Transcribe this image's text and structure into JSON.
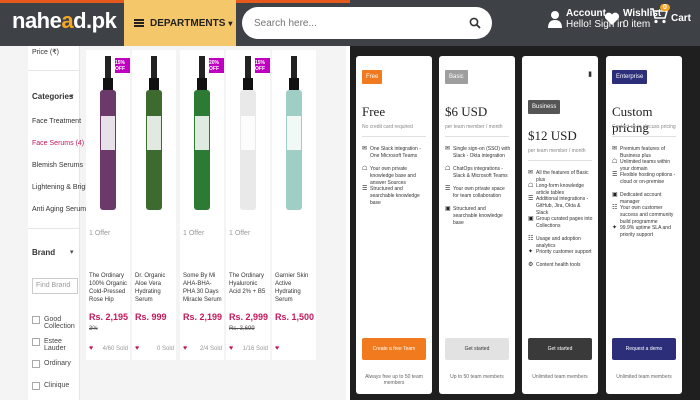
{
  "header": {
    "logo_text": "nahe",
    "logo_o": "e",
    "logo_tail": "d.pk",
    "departments_label": "DEPARTMENTS",
    "search_placeholder": "Search here...",
    "account_label": "Account",
    "account_sub": "Hello! Sign in",
    "wishlist_label": "Wishlist",
    "wishlist_sub": "0 item",
    "cart_label": "Cart",
    "cart_count": "0",
    "accent": "#f5a623",
    "header_bg": "#3e4146"
  },
  "sidebar": {
    "top_label": "Price (₹)",
    "categories_title": "Categories",
    "categories": [
      {
        "label": "Face Treatment",
        "active": false
      },
      {
        "label": "Face Serums (4)",
        "active": true
      },
      {
        "label": "Blemish Serums",
        "active": false
      },
      {
        "label": "Lightening & Brightening",
        "active": false
      },
      {
        "label": "Anti Aging Serum (1)",
        "active": false
      }
    ],
    "brand_title": "Brand",
    "brand_filter_placeholder": "Find Brand",
    "brands": [
      "Good Collection",
      "Estee Lauder",
      "Ordinary",
      "Clinique"
    ]
  },
  "products": [
    {
      "name": "The Ordinary 100% Organic Cold-Pressed Rose Hip",
      "price": "Rs. 2,195",
      "old_price": "3%",
      "sold": "4/60 Sold",
      "badge": "15% OFF",
      "label": "1 Offer",
      "color": "#6b3a6b"
    },
    {
      "name": "Dr. Organic Aloe Vera Hydrating Serum",
      "price": "Rs. 999",
      "old_price": "",
      "sold": "0 Sold",
      "badge": "",
      "label": "",
      "color": "#3d6b2f"
    },
    {
      "name": "Some By Mi AHA-BHA-PHA 30 Days Miracle Serum",
      "price": "Rs. 2,199",
      "old_price": "",
      "sold": "2/4 Sold",
      "badge": "20% OFF",
      "label": "1 Offer",
      "color": "#2d7a34"
    },
    {
      "name": "The Ordinary Hyaluronic Acid 2% + B5",
      "price": "Rs. 2,999",
      "old_price": "Rs. 3,699",
      "sold": "1/16 Sold",
      "badge": "15% OFF",
      "label": "1 Offer",
      "color": "#e9e9e9"
    },
    {
      "name": "Garnier Skin Active Hydrating Serum",
      "price": "Rs. 1,500",
      "old_price": "",
      "sold": "",
      "badge": "",
      "label": "",
      "color": "#9fcfc4"
    }
  ],
  "plans": [
    {
      "tag": "Free",
      "tag_color": "#f07a1d",
      "name": "Free",
      "sub": "No credit card required",
      "features": [
        "One Slack integration - One Microsoft Teams",
        "Your own private knowledge base and answer Sources",
        "Structured and searchable knowledge base"
      ],
      "button": "Create a free Team",
      "button_bg": "#f07a1d",
      "button_fg": "#ffffff",
      "footer": "Always free up to 50 team members"
    },
    {
      "tag": "Basic",
      "tag_color": "#9e9e9e",
      "name": "$6 USD",
      "sub": "per team member / month",
      "features": [
        "Single sign-on (SSO) with Slack - Okta integration",
        "ChatOps integrations - Slack & Microsoft Teams",
        "Your own private space for team collaboration",
        "Structured and searchable knowledge base"
      ],
      "button": "Get started",
      "button_bg": "#e2e2e2",
      "button_fg": "#333333",
      "footer": "Up to 50 team members"
    },
    {
      "tag": "Business",
      "tag_color": "#555555",
      "name": "$12 USD",
      "sub": "per team member / month",
      "features": [
        "All the features of Basic plus",
        "Long-form knowledge article tables",
        "Additional integrations - GitHub, Jira, Okta & Slack",
        "Group curated pages into Collections",
        "Usage and adoption analytics",
        "Priority customer support",
        "Content health tools"
      ],
      "button": "Get started",
      "button_bg": "#3a3a3a",
      "button_fg": "#ffffff",
      "footer": "Unlimited team members"
    },
    {
      "tag": "Enterprise",
      "tag_color": "#2c2e7a",
      "name": "Custom pricing",
      "sub": "Contact us to discuss pricing",
      "features": [
        "Premium features of Business plus",
        "Unlimited teams within your domain",
        "Flexible hosting options - cloud or on-premise",
        "Dedicated account manager",
        "Your own customer success and community build programme",
        "99.9% uptime SLA and priority support"
      ],
      "button": "Request a demo",
      "button_bg": "#2c2e7a",
      "button_fg": "#ffffff",
      "footer": "Unlimited team members"
    }
  ]
}
